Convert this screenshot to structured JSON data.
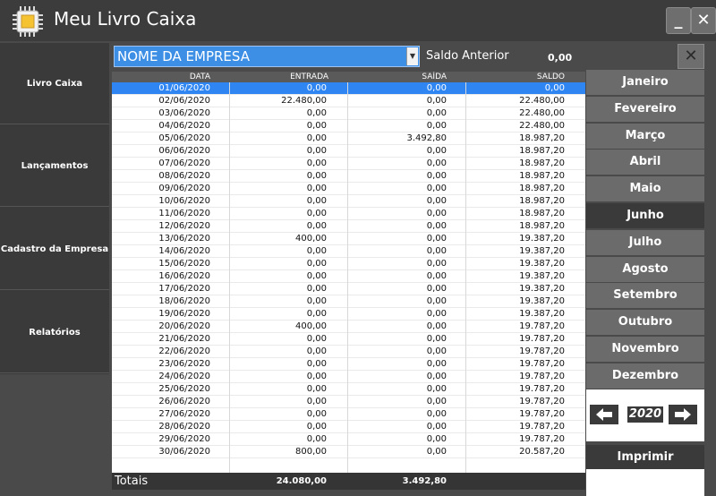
{
  "window": {
    "title": "Meu Livro Caixa",
    "minimize_label": "_",
    "close_label": "✕"
  },
  "sidebar": {
    "items": [
      {
        "label": "Livro Caixa"
      },
      {
        "label": "Lançamentos"
      },
      {
        "label": "Cadastro da Empresa"
      },
      {
        "label": "Relatórios"
      }
    ]
  },
  "toolbar": {
    "company": "NOME DA EMPRESA",
    "saldo_anterior_label": "Saldo Anterior",
    "saldo_anterior_value": "0,00",
    "close_label": "✕"
  },
  "table": {
    "headers": [
      "DATA",
      "ENTRADA",
      "SAÍDA",
      "SALDO"
    ],
    "rows": [
      [
        "01/06/2020",
        "0,00",
        "0,00",
        "0,00"
      ],
      [
        "02/06/2020",
        "22.480,00",
        "0,00",
        "22.480,00"
      ],
      [
        "03/06/2020",
        "0,00",
        "0,00",
        "22.480,00"
      ],
      [
        "04/06/2020",
        "0,00",
        "0,00",
        "22.480,00"
      ],
      [
        "05/06/2020",
        "0,00",
        "3.492,80",
        "18.987,20"
      ],
      [
        "06/06/2020",
        "0,00",
        "0,00",
        "18.987,20"
      ],
      [
        "07/06/2020",
        "0,00",
        "0,00",
        "18.987,20"
      ],
      [
        "08/06/2020",
        "0,00",
        "0,00",
        "18.987,20"
      ],
      [
        "09/06/2020",
        "0,00",
        "0,00",
        "18.987,20"
      ],
      [
        "10/06/2020",
        "0,00",
        "0,00",
        "18.987,20"
      ],
      [
        "11/06/2020",
        "0,00",
        "0,00",
        "18.987,20"
      ],
      [
        "12/06/2020",
        "0,00",
        "0,00",
        "18.987,20"
      ],
      [
        "13/06/2020",
        "400,00",
        "0,00",
        "19.387,20"
      ],
      [
        "14/06/2020",
        "0,00",
        "0,00",
        "19.387,20"
      ],
      [
        "15/06/2020",
        "0,00",
        "0,00",
        "19.387,20"
      ],
      [
        "16/06/2020",
        "0,00",
        "0,00",
        "19.387,20"
      ],
      [
        "17/06/2020",
        "0,00",
        "0,00",
        "19.387,20"
      ],
      [
        "18/06/2020",
        "0,00",
        "0,00",
        "19.387,20"
      ],
      [
        "19/06/2020",
        "0,00",
        "0,00",
        "19.387,20"
      ],
      [
        "20/06/2020",
        "400,00",
        "0,00",
        "19.787,20"
      ],
      [
        "21/06/2020",
        "0,00",
        "0,00",
        "19.787,20"
      ],
      [
        "22/06/2020",
        "0,00",
        "0,00",
        "19.787,20"
      ],
      [
        "23/06/2020",
        "0,00",
        "0,00",
        "19.787,20"
      ],
      [
        "24/06/2020",
        "0,00",
        "0,00",
        "19.787,20"
      ],
      [
        "25/06/2020",
        "0,00",
        "0,00",
        "19.787,20"
      ],
      [
        "26/06/2020",
        "0,00",
        "0,00",
        "19.787,20"
      ],
      [
        "27/06/2020",
        "0,00",
        "0,00",
        "19.787,20"
      ],
      [
        "28/06/2020",
        "0,00",
        "0,00",
        "19.787,20"
      ],
      [
        "29/06/2020",
        "0,00",
        "0,00",
        "19.787,20"
      ],
      [
        "30/06/2020",
        "800,00",
        "0,00",
        "20.587,20"
      ]
    ],
    "selected_row": 0
  },
  "totals": {
    "label": "Totais",
    "entrada": "24.080,00",
    "saida": "3.492,80"
  },
  "months": {
    "items": [
      "Janeiro",
      "Fevereiro",
      "Março",
      "Abril",
      "Maio",
      "Junho",
      "Julho",
      "Agosto",
      "Setembro",
      "Outubro",
      "Novembro",
      "Dezembro"
    ],
    "active": 5
  },
  "year": {
    "value": "2020",
    "prev_label": "🡐",
    "next_label": "🡒"
  },
  "print_label": "Imprimir",
  "colors": {
    "accent": "#2f86f2",
    "dark": "#3a3a3a",
    "month_button": "#6b6b6b"
  }
}
